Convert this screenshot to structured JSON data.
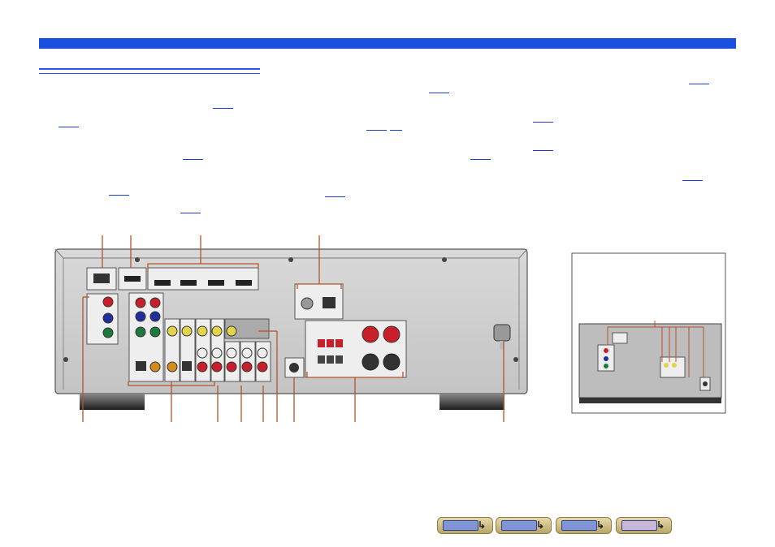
{
  "page": {
    "header_bar_color": "#1a4fe0",
    "leader_color": "#b4542a"
  },
  "navigation": {
    "buttons": [
      {
        "name": "front-panel-nav-button",
        "icon": "front-panel-icon"
      },
      {
        "name": "display-nav-button",
        "icon": "display-icon"
      },
      {
        "name": "rear-panel-nav-button",
        "icon": "rear-panel-icon"
      },
      {
        "name": "remote-control-nav-button",
        "icon": "remote-control-icon"
      }
    ],
    "arrow_glyph": "↳"
  }
}
